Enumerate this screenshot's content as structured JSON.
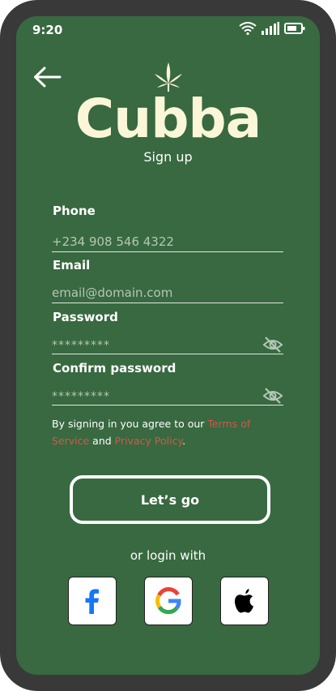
{
  "status": {
    "time": "9:20"
  },
  "brand": {
    "name": "Cubba",
    "subtitle": "Sign up"
  },
  "form": {
    "phone": {
      "label": "Phone",
      "value": "+234 908 546 4322"
    },
    "email": {
      "label": "Email",
      "placeholder": "email@domain.com"
    },
    "password": {
      "label": "Password",
      "value": "*********"
    },
    "confirm": {
      "label": "Confirm password",
      "value": "*********"
    }
  },
  "terms": {
    "prefix": "By signing in you agree to our ",
    "tos": "Terms of Service",
    "and": " and ",
    "privacy": "Privacy Policy",
    "suffix": "."
  },
  "submit_label": "Let’s go",
  "alt_login": "or login with",
  "social": [
    {
      "name": "facebook-icon"
    },
    {
      "name": "google-icon"
    },
    {
      "name": "apple-icon"
    }
  ],
  "colors": {
    "background": "#386940",
    "brand_text": "#fbf6d8",
    "link": "#d2584a",
    "frame": "#393939"
  }
}
